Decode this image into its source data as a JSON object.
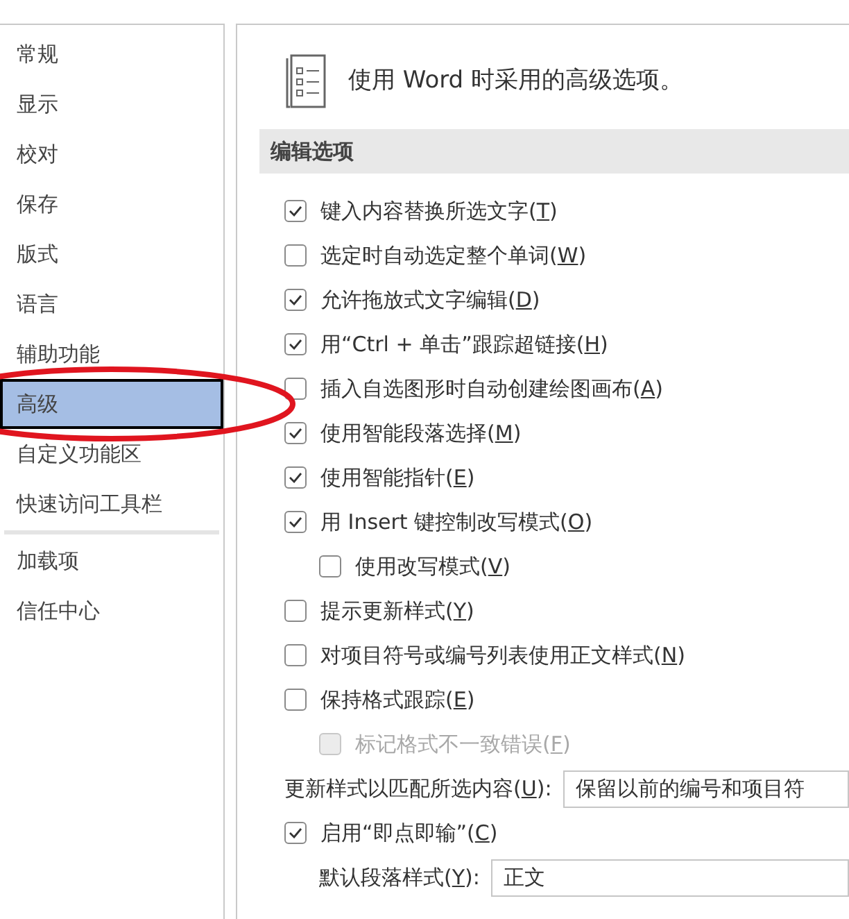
{
  "sidebar": {
    "items": [
      {
        "label": "常规",
        "selected": false
      },
      {
        "label": "显示",
        "selected": false
      },
      {
        "label": "校对",
        "selected": false
      },
      {
        "label": "保存",
        "selected": false
      },
      {
        "label": "版式",
        "selected": false
      },
      {
        "label": "语言",
        "selected": false
      },
      {
        "label": "辅助功能",
        "selected": false
      },
      {
        "label": "高级",
        "selected": true
      },
      {
        "label": "自定义功能区",
        "selected": false
      },
      {
        "label": "快速访问工具栏",
        "selected": false,
        "divider_after": true
      },
      {
        "label": "加载项",
        "selected": false
      },
      {
        "label": "信任中心",
        "selected": false
      }
    ]
  },
  "header": {
    "title": "使用 Word 时采用的高级选项。"
  },
  "section": {
    "title": "编辑选项"
  },
  "options": [
    {
      "kind": "checkbox",
      "label": "键入内容替换所选文字(T)",
      "checked": true
    },
    {
      "kind": "checkbox",
      "label": "选定时自动选定整个单词(W)",
      "checked": false
    },
    {
      "kind": "checkbox",
      "label": "允许拖放式文字编辑(D)",
      "checked": true
    },
    {
      "kind": "checkbox",
      "label": "用“Ctrl + 单击”跟踪超链接(H)",
      "checked": true
    },
    {
      "kind": "checkbox",
      "label": "插入自选图形时自动创建绘图画布(A)",
      "checked": false
    },
    {
      "kind": "checkbox",
      "label": "使用智能段落选择(M)",
      "checked": true
    },
    {
      "kind": "checkbox",
      "label": "使用智能指针(E)",
      "checked": true
    },
    {
      "kind": "checkbox",
      "label": "用 Insert 键控制改写模式(O)",
      "checked": true,
      "children": [
        {
          "kind": "checkbox",
          "label": "使用改写模式(V)",
          "checked": false,
          "disabled": false
        }
      ]
    },
    {
      "kind": "checkbox",
      "label": "提示更新样式(Y)",
      "checked": false
    },
    {
      "kind": "checkbox",
      "label": "对项目符号或编号列表使用正文样式(N)",
      "checked": false
    },
    {
      "kind": "checkbox",
      "label": "保持格式跟踪(E)",
      "checked": false,
      "children": [
        {
          "kind": "checkbox",
          "label": "标记格式不一致错误(F)",
          "checked": false,
          "disabled": true
        }
      ]
    },
    {
      "kind": "select",
      "label": "更新样式以匹配所选内容(U):",
      "value": "保留以前的编号和项目符"
    },
    {
      "kind": "checkbox",
      "label": "启用“即点即输”(C)",
      "checked": true,
      "children": [
        {
          "kind": "select",
          "label": "默认段落样式(Y):",
          "value": "正文"
        }
      ]
    }
  ]
}
